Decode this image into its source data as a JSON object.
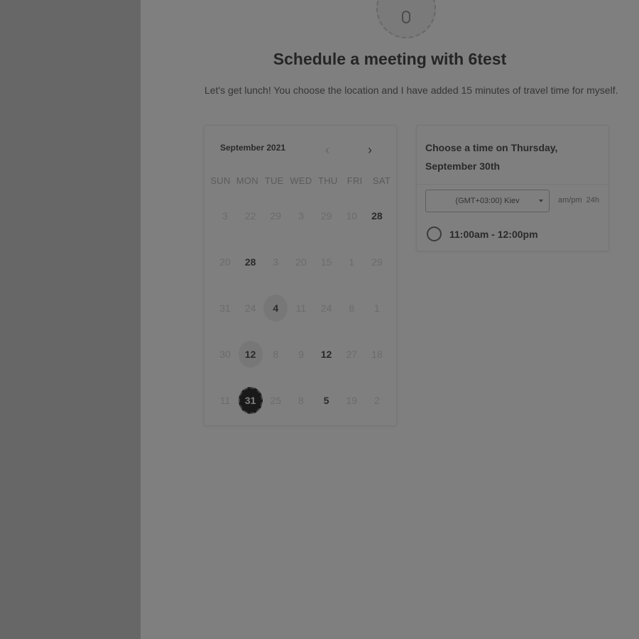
{
  "meeting": {
    "title": "Schedule a meeting with 6test",
    "description": "Let's get lunch! You choose the location and I have added 15 minutes of travel time for myself."
  },
  "calendar": {
    "month_label": "September 2021",
    "weekdays": [
      "SUN",
      "MON",
      "TUE",
      "WED",
      "THU",
      "FRI",
      "SAT"
    ],
    "weeks": [
      [
        {
          "d": "3",
          "s": "off"
        },
        {
          "d": "22",
          "s": "off"
        },
        {
          "d": "29",
          "s": "off"
        },
        {
          "d": "3",
          "s": "off"
        },
        {
          "d": "29",
          "s": "off"
        },
        {
          "d": "10",
          "s": "off"
        },
        {
          "d": "28",
          "s": "available"
        }
      ],
      [
        {
          "d": "20",
          "s": "off"
        },
        {
          "d": "28",
          "s": "available"
        },
        {
          "d": "3",
          "s": "off"
        },
        {
          "d": "20",
          "s": "off"
        },
        {
          "d": "15",
          "s": "off"
        },
        {
          "d": "1",
          "s": "off"
        },
        {
          "d": "29",
          "s": "off"
        }
      ],
      [
        {
          "d": "31",
          "s": "off"
        },
        {
          "d": "24",
          "s": "off"
        },
        {
          "d": "4",
          "s": "highlight"
        },
        {
          "d": "11",
          "s": "off"
        },
        {
          "d": "24",
          "s": "off"
        },
        {
          "d": "8",
          "s": "off"
        },
        {
          "d": "1",
          "s": "off"
        }
      ],
      [
        {
          "d": "30",
          "s": "off"
        },
        {
          "d": "12",
          "s": "highlight"
        },
        {
          "d": "8",
          "s": "off"
        },
        {
          "d": "9",
          "s": "off"
        },
        {
          "d": "12",
          "s": "available"
        },
        {
          "d": "27",
          "s": "off"
        },
        {
          "d": "18",
          "s": "off"
        }
      ],
      [
        {
          "d": "11",
          "s": "off"
        },
        {
          "d": "31",
          "s": "selected"
        },
        {
          "d": "25",
          "s": "off"
        },
        {
          "d": "8",
          "s": "off"
        },
        {
          "d": "5",
          "s": "available"
        },
        {
          "d": "19",
          "s": "off"
        },
        {
          "d": "2",
          "s": "off"
        }
      ]
    ]
  },
  "time_panel": {
    "header": "Choose a time on Thursday, September 30th",
    "timezone": "(GMT+03:00) Kiev",
    "format_options": [
      "am/pm",
      "24h"
    ],
    "slot": "11:00am - 12:00pm"
  },
  "icons": {
    "nav_prev": "chevron-left-icon",
    "nav_next": "chevron-right-icon",
    "avatar": "user-avatar-icon"
  }
}
